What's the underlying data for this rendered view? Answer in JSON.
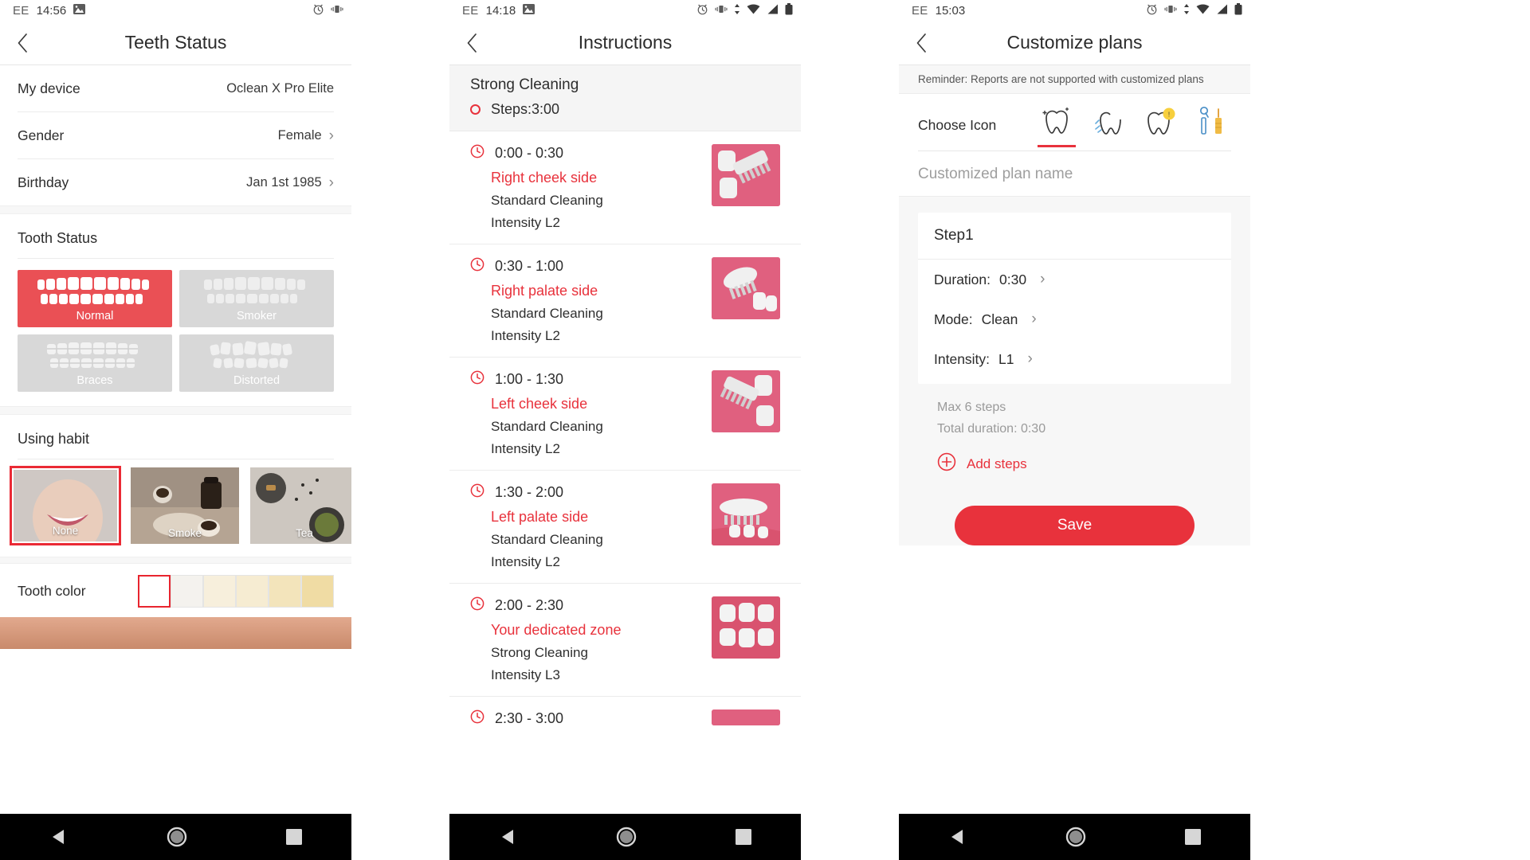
{
  "panels": [
    {
      "status": {
        "carrier": "EE",
        "time": "14:56",
        "icons": [
          "image-icon",
          "alarm-icon",
          "vibrate-icon"
        ]
      },
      "nav": {
        "back": "back-icon",
        "title": "Teeth Status"
      },
      "rows": [
        {
          "label": "My device",
          "value": "Oclean X Pro Elite",
          "chevron": ""
        },
        {
          "label": "Gender",
          "value": "Female",
          "chevron": "›"
        },
        {
          "label": "Birthday",
          "value": "Jan 1st 1985",
          "chevron": "›"
        }
      ],
      "tooth_status": {
        "title": "Tooth Status",
        "options": [
          {
            "label": "Normal",
            "selected": true
          },
          {
            "label": "Smoker",
            "selected": false
          },
          {
            "label": "Braces",
            "selected": false
          },
          {
            "label": "Distorted",
            "selected": false
          }
        ]
      },
      "using_habit": {
        "title": "Using habit",
        "options": [
          {
            "label": "None",
            "selected": true
          },
          {
            "label": "Smoke",
            "selected": false
          },
          {
            "label": "Tea",
            "selected": false
          }
        ]
      },
      "tooth_color": {
        "label": "Tooth color",
        "swatches": [
          "#ffffff",
          "#f4f2ee",
          "#f7efdc",
          "#f6ecd2",
          "#f3e4bb",
          "#f0dca4"
        ],
        "selected_index": 0
      }
    },
    {
      "status": {
        "carrier": "EE",
        "time": "14:18",
        "icons": [
          "image-icon",
          "alarm-icon",
          "vibrate-icon",
          "sync-icon",
          "wifi-icon",
          "signal-icon",
          "battery-icon"
        ]
      },
      "nav": {
        "back": "back-icon",
        "title": "Instructions"
      },
      "header": {
        "plan": "Strong Cleaning",
        "steps": "Steps:3:00"
      },
      "steps": [
        {
          "time": "0:00 - 0:30",
          "zone": "Right cheek side",
          "mode": "Standard Cleaning",
          "intensity": "Intensity L2"
        },
        {
          "time": "0:30 - 1:00",
          "zone": "Right palate side",
          "mode": "Standard Cleaning",
          "intensity": "Intensity L2"
        },
        {
          "time": "1:00 - 1:30",
          "zone": "Left cheek side",
          "mode": "Standard Cleaning",
          "intensity": "Intensity L2"
        },
        {
          "time": "1:30 - 2:00",
          "zone": "Left palate side",
          "mode": "Standard Cleaning",
          "intensity": "Intensity L2"
        },
        {
          "time": "2:00 - 2:30",
          "zone": "Your dedicated zone",
          "mode": "Strong Cleaning",
          "intensity": "Intensity L3"
        },
        {
          "time": "2:30 - 3:00",
          "zone": "",
          "mode": "",
          "intensity": ""
        }
      ]
    },
    {
      "status": {
        "carrier": "EE",
        "time": "15:03",
        "icons": [
          "alarm-icon",
          "vibrate-icon",
          "sync-icon",
          "wifi-icon",
          "signal-icon",
          "battery-icon"
        ]
      },
      "nav": {
        "back": "back-icon",
        "title": "Customize plans"
      },
      "reminder": "Reminder: Reports are not supported with customized plans",
      "choose_icon": {
        "label": "Choose Icon",
        "icons": [
          {
            "name": "sparkle-tooth-icon",
            "selected": true
          },
          {
            "name": "clean-tooth-icon",
            "selected": false
          },
          {
            "name": "sensitive-tooth-icon",
            "selected": false
          },
          {
            "name": "dental-tools-icon",
            "selected": false
          }
        ]
      },
      "plan_name_placeholder": "Customized plan name",
      "step_card": {
        "name": "Step1",
        "fields": [
          {
            "label": "Duration:",
            "value": "0:30",
            "chevron": "›"
          },
          {
            "label": "Mode:",
            "value": "Clean",
            "chevron": "›"
          },
          {
            "label": "Intensity:",
            "value": "L1",
            "chevron": "›"
          }
        ]
      },
      "meta": {
        "max": "Max 6 steps",
        "total": "Total duration:  0:30"
      },
      "add_steps": "Add steps",
      "save": "Save"
    }
  ],
  "android_nav": {
    "back": "nav-back-icon",
    "home": "nav-home-icon",
    "recents": "nav-recents-icon"
  },
  "colors": {
    "accent": "#e8323c",
    "selected_card": "#ea5055",
    "muted_card": "#d8d8d8",
    "thumb": "#de5878"
  }
}
